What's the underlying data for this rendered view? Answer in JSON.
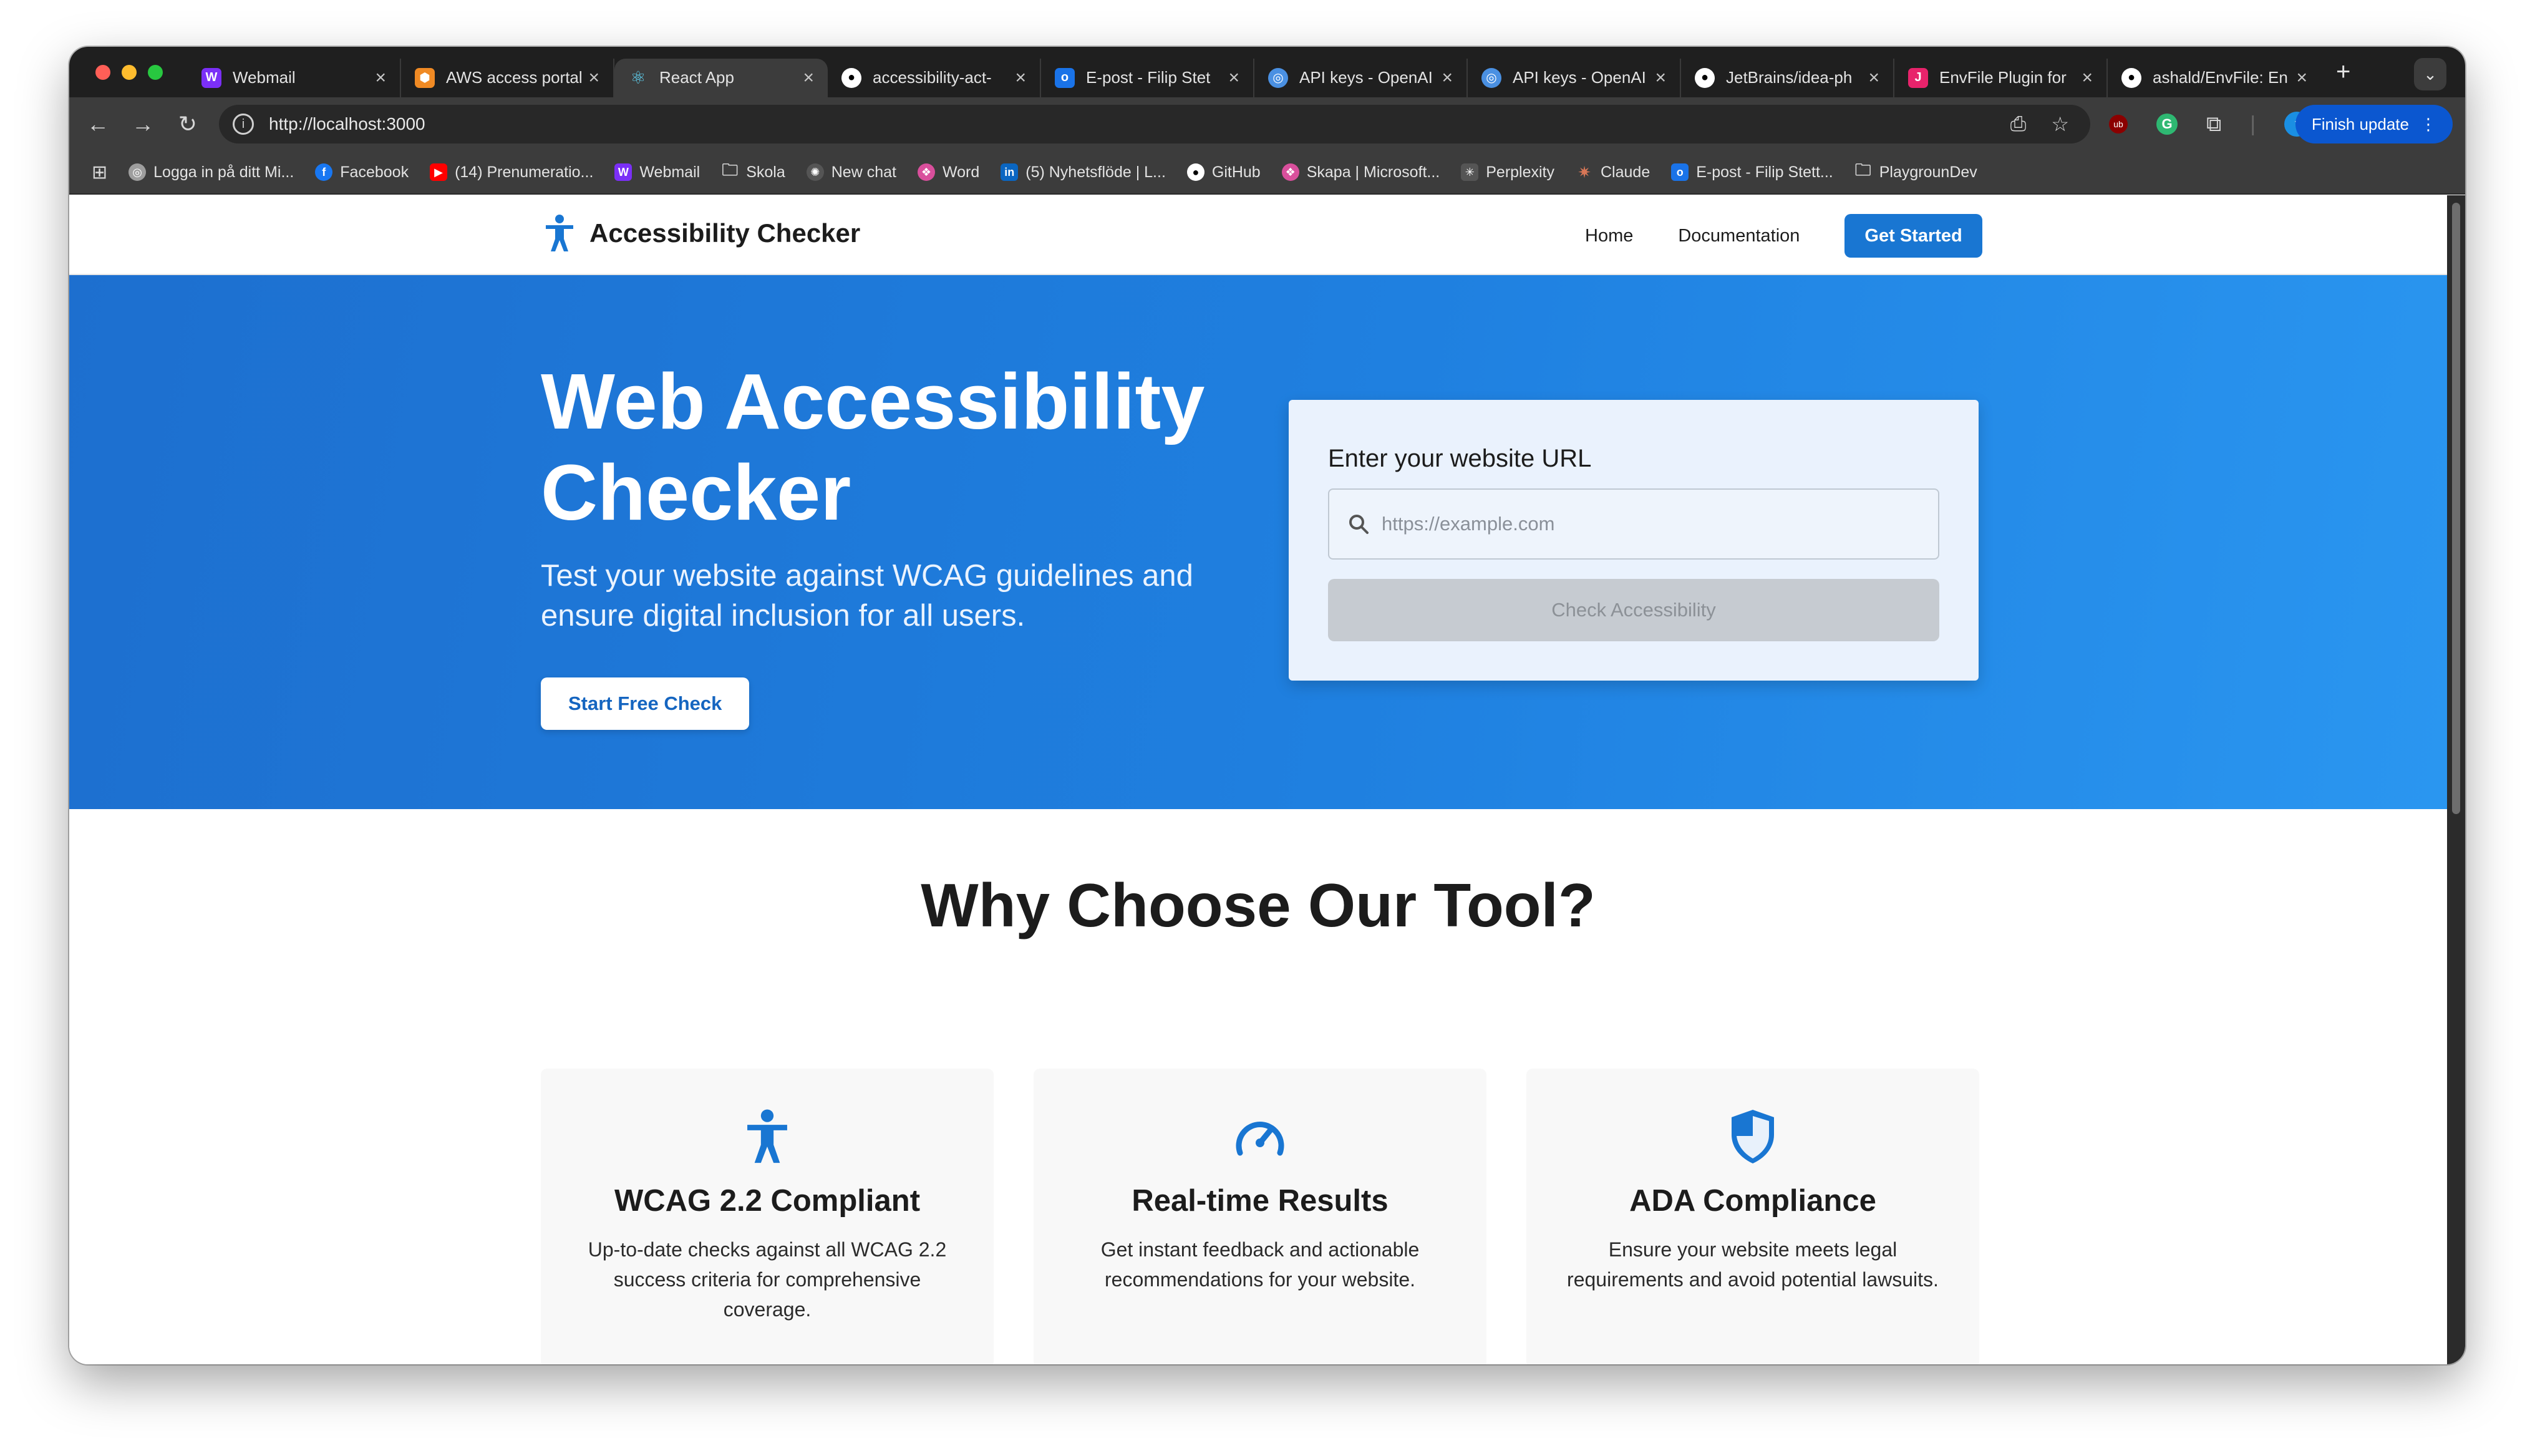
{
  "browser": {
    "tabs": [
      {
        "title": "Webmail",
        "icon": "webmail-icon",
        "color": "#7b2ff7",
        "active": false
      },
      {
        "title": "AWS access portal",
        "icon": "aws-icon",
        "color": "#f08a24",
        "active": false
      },
      {
        "title": "React App",
        "icon": "react-icon",
        "color": "#61dafb",
        "active": true
      },
      {
        "title": "accessibility-act-",
        "icon": "github-icon",
        "color": "#ffffff",
        "active": false
      },
      {
        "title": "E-post - Filip Stet",
        "icon": "outlook-icon",
        "color": "#1a73e8",
        "active": false
      },
      {
        "title": "API keys - OpenAI",
        "icon": "globe-icon",
        "color": "#4a90e2",
        "active": false
      },
      {
        "title": "API keys - OpenAI",
        "icon": "globe-icon",
        "color": "#4a90e2",
        "active": false
      },
      {
        "title": "JetBrains/idea-ph",
        "icon": "github-icon",
        "color": "#ffffff",
        "active": false
      },
      {
        "title": "EnvFile Plugin for",
        "icon": "jetbrains-icon",
        "color": "#e8236b",
        "active": false
      },
      {
        "title": "ashald/EnvFile: En",
        "icon": "github-icon",
        "color": "#ffffff",
        "active": false
      }
    ],
    "url": "http://localhost:3000",
    "finish_update_label": "Finish update",
    "bookmarks": [
      {
        "label": "Logga in på ditt Mi...",
        "icon": "globe-icon",
        "color": "#9e9e9e"
      },
      {
        "label": "Facebook",
        "icon": "facebook-icon",
        "color": "#1877f2"
      },
      {
        "label": "(14) Prenumeratio...",
        "icon": "youtube-icon",
        "color": "#ff0000"
      },
      {
        "label": "Webmail",
        "icon": "webmail-icon",
        "color": "#7b2ff7"
      },
      {
        "label": "Skola",
        "icon": "folder-icon",
        "color": "transparent"
      },
      {
        "label": "New chat",
        "icon": "openai-icon",
        "color": "#555555"
      },
      {
        "label": "Word",
        "icon": "word-icon",
        "color": "#d94f9c"
      },
      {
        "label": "(5) Nyhetsflöde | L...",
        "icon": "linkedin-icon",
        "color": "#0a66c2"
      },
      {
        "label": "GitHub",
        "icon": "github-icon",
        "color": "#555555"
      },
      {
        "label": "Skapa | Microsoft...",
        "icon": "copilot-icon",
        "color": "#d94f9c"
      },
      {
        "label": "Perplexity",
        "icon": "perplexity-icon",
        "color": "#555555"
      },
      {
        "label": "Claude",
        "icon": "claude-icon",
        "color": "#d97757"
      },
      {
        "label": "E-post - Filip Stett...",
        "icon": "outlook-icon",
        "color": "#1a73e8"
      },
      {
        "label": "PlaygrounDev",
        "icon": "folder-icon",
        "color": "transparent"
      }
    ]
  },
  "site": {
    "brand": "Accessibility Checker",
    "nav": {
      "home": "Home",
      "documentation": "Documentation",
      "get_started": "Get Started"
    },
    "hero": {
      "title": "Web Accessibility Checker",
      "subtitle": "Test your website against WCAG guidelines and ensure digital inclusion for all users.",
      "start_button": "Start Free Check"
    },
    "url_card": {
      "label": "Enter your website URL",
      "placeholder": "https://example.com",
      "check_button": "Check Accessibility"
    },
    "why_heading": "Why Choose Our Tool?",
    "features": [
      {
        "icon": "accessibility-icon",
        "title": "WCAG 2.2 Compliant",
        "text": "Up-to-date checks against all WCAG 2.2 success criteria for comprehensive coverage."
      },
      {
        "icon": "speedometer-icon",
        "title": "Real-time Results",
        "text": "Get instant feedback and actionable recommendations for your website."
      },
      {
        "icon": "shield-icon",
        "title": "ADA Compliance",
        "text": "Ensure your website meets legal requirements and avoid potential lawsuits."
      }
    ],
    "accent_color": "#1976d2"
  }
}
